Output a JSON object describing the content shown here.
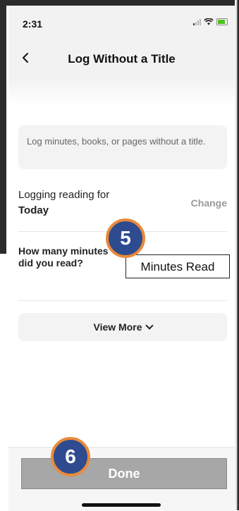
{
  "status_bar": {
    "time": "2:31"
  },
  "nav": {
    "title": "Log Without a Title"
  },
  "info": {
    "text": "Log minutes, books, or pages without a title."
  },
  "logging": {
    "label": "Logging reading for",
    "value": "Today",
    "change_label": "Change"
  },
  "minutes": {
    "question": "How many minutes did you read?",
    "input_value": "Minutes Read"
  },
  "view_more": {
    "label": "View More"
  },
  "done": {
    "label": "Done"
  },
  "annotations": {
    "step_5": "5",
    "step_6": "6"
  },
  "colors": {
    "badge_fill": "#2f4b8f",
    "badge_border": "#e98a3a",
    "done_bg": "#a7a7a7",
    "panel_bg": "#f3f3f3"
  }
}
